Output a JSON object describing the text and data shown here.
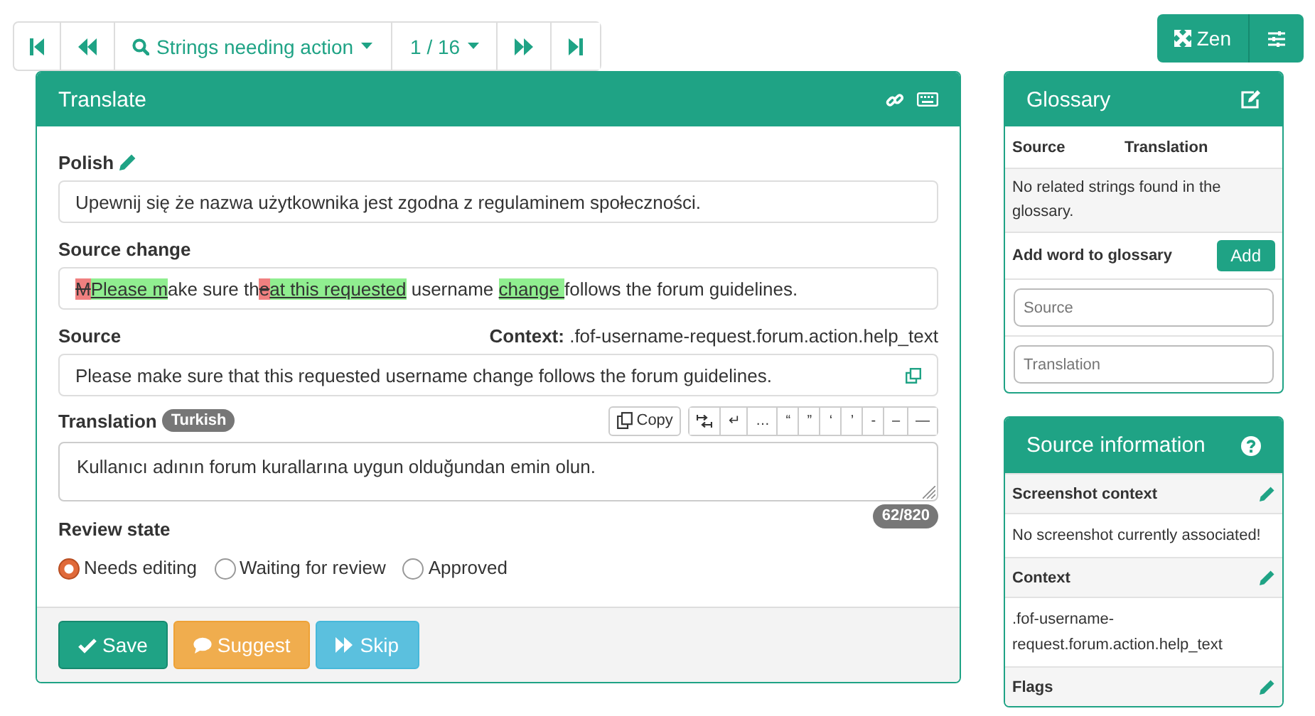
{
  "navigation": {
    "filter": "Strings needing action",
    "position": "1 / 16"
  },
  "zen_button": "Zen",
  "translate": {
    "title": "Translate",
    "other_language": {
      "label": "Polish",
      "text": "Upewnij się że nazwa użytkownika jest zgodna z regulaminem społeczności."
    },
    "source_change": {
      "label": "Source change",
      "segments": [
        {
          "kind": "del",
          "text": "M"
        },
        {
          "kind": "ins",
          "text": "Please m"
        },
        {
          "kind": "same",
          "text": "ake sure th"
        },
        {
          "kind": "del",
          "text": "e"
        },
        {
          "kind": "ins",
          "text": "at this requested"
        },
        {
          "kind": "same",
          "text": " username "
        },
        {
          "kind": "ins",
          "text": "change "
        },
        {
          "kind": "same",
          "text": "follows the forum guidelines."
        }
      ]
    },
    "source": {
      "label": "Source",
      "context_label": "Context:",
      "context_value": ".fof-username-request.forum.action.help_text",
      "text": "Please make sure that this requested username change follows the forum guidelines."
    },
    "translation": {
      "label": "Translation",
      "language": "Turkish",
      "copy_button": "Copy",
      "special_characters": [
        "↵",
        "…",
        "“",
        "”",
        "‘",
        "’",
        "-",
        "–",
        "—"
      ],
      "value": "Kullanıcı adının forum kurallarına uygun olduğundan emin olun.",
      "counter": "62/820"
    },
    "review": {
      "label": "Review state",
      "options": [
        {
          "label": "Needs editing",
          "selected": true
        },
        {
          "label": "Waiting for review",
          "selected": false
        },
        {
          "label": "Approved",
          "selected": false
        }
      ]
    },
    "buttons": [
      {
        "kind": "save",
        "label": "Save"
      },
      {
        "kind": "suggest",
        "label": "Suggest"
      },
      {
        "kind": "skip",
        "label": "Skip"
      }
    ]
  },
  "glossary": {
    "title": "Glossary",
    "columns": [
      "Source",
      "Translation"
    ],
    "empty_message": "No related strings found in the glossary.",
    "add_label": "Add word to glossary",
    "add_button": "Add",
    "source_placeholder": "Source",
    "translation_placeholder": "Translation"
  },
  "source_information": {
    "title": "Source information",
    "sections": [
      {
        "heading": "Screenshot context",
        "text": "No screenshot currently associated!"
      },
      {
        "heading": "Context",
        "text": ".fof-username-request.forum.action.help_text"
      },
      {
        "heading": "Flags"
      }
    ]
  }
}
